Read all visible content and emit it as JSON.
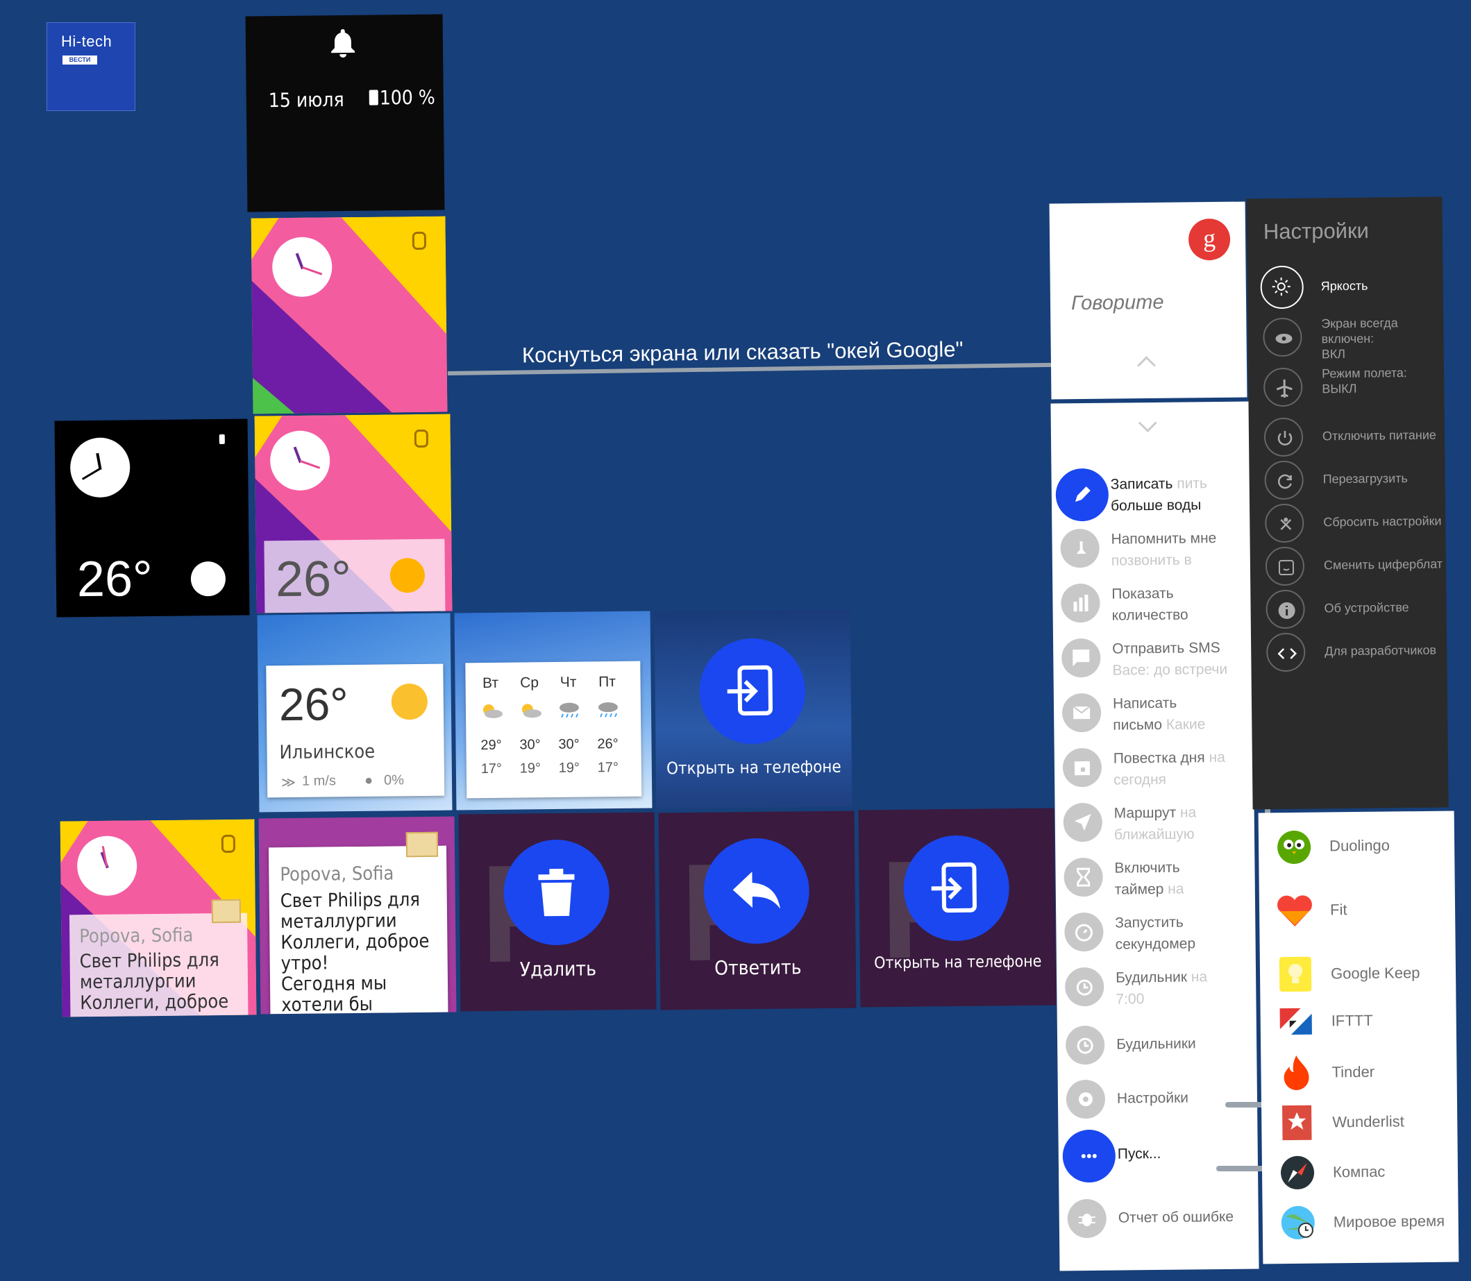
{
  "logo": {
    "title": "Hi-tech",
    "badge": "ВЕСТИ"
  },
  "lock": {
    "date": "15 июля",
    "battery": "100 %"
  },
  "caption": "Коснуться экрана или сказать \"окей Google\"",
  "weather": {
    "temp": "26°",
    "place": "Ильинское",
    "wind": "1 m/s",
    "rain": "0%",
    "forecast": [
      {
        "day": "Вт",
        "high": "29°",
        "low": "17°",
        "icon": "partly-sunny-icon"
      },
      {
        "day": "Ср",
        "high": "30°",
        "low": "19°",
        "icon": "partly-sunny-icon"
      },
      {
        "day": "Чт",
        "high": "30°",
        "low": "19°",
        "icon": "rain-icon"
      },
      {
        "day": "Пт",
        "high": "26°",
        "low": "17°",
        "icon": "rain-icon"
      }
    ]
  },
  "actions": {
    "open_phone": "Открыть на телефоне",
    "delete": "Удалить",
    "reply": "Ответить"
  },
  "mail": {
    "sender": "Popova, Sofia",
    "line1": "Свет Philips для",
    "line2": "металлургии",
    "line3": "Коллеги, доброе",
    "line4": "утро!",
    "line5": "Сегодня мы",
    "line6": "хотели бы",
    "mini_line3": "Коллеги, доброе"
  },
  "voice": {
    "google_badge": "g",
    "prompt": "Говорите",
    "items": [
      {
        "main": "Записать",
        "hint": " пить",
        "line2": "больше воды",
        "icon": "pencil-icon"
      },
      {
        "main": "Напомнить мне",
        "hint": "",
        "line2": "",
        "line2_hint": "позвонить в",
        "icon": "reminder-icon"
      },
      {
        "main": "Показать",
        "hint": "",
        "line2": "количество",
        "icon": "bar-chart-icon"
      },
      {
        "main": "Отправить SMS",
        "hint": "",
        "line2": "",
        "line2_hint": "Васе: до встречи",
        "icon": "sms-icon"
      },
      {
        "main": "Написать",
        "hint": "",
        "line2": "письмо",
        "line2_hint": " Какие",
        "icon": "mail-icon"
      },
      {
        "main": "Повестка дня",
        "hint": " на",
        "line2": "",
        "line2_hint": "сегодня",
        "icon": "calendar-icon"
      },
      {
        "main": "Маршрут",
        "hint": " на",
        "line2": "",
        "line2_hint": "ближайшую",
        "icon": "navigation-icon"
      },
      {
        "main": "Включить",
        "hint": "",
        "line2": "таймер",
        "line2_hint": " на",
        "icon": "hourglass-icon"
      },
      {
        "main": "Запустить",
        "hint": "",
        "line2": "секундомер",
        "icon": "stopwatch-icon"
      },
      {
        "main": "Будильник",
        "hint": " на",
        "line2": "",
        "line2_hint": "7:00",
        "icon": "alarm-icon"
      },
      {
        "main": "Будильники",
        "hint": "",
        "line2": "",
        "icon": "alarms-icon"
      },
      {
        "main": "Настройки",
        "hint": "",
        "line2": "",
        "icon": "gear-icon"
      },
      {
        "main": "Пуск...",
        "hint": "",
        "line2": "",
        "icon": "more-icon"
      },
      {
        "main": "Отчет об ошибке",
        "hint": "",
        "line2": "",
        "icon": "bug-icon"
      }
    ]
  },
  "settings": {
    "title": "Настройки",
    "items": [
      {
        "label": "Яркость",
        "icon": "brightness-icon"
      },
      {
        "label": "Экран всегда",
        "label2": "включен:",
        "label3": "ВКЛ",
        "icon": "eye-icon"
      },
      {
        "label": "Режим полета:",
        "label2": "ВЫКЛ",
        "icon": "airplane-icon"
      },
      {
        "label": "Отключить питание",
        "icon": "power-icon"
      },
      {
        "label": "Перезагрузить",
        "icon": "restart-icon"
      },
      {
        "label": "Сбросить настройки",
        "icon": "reset-icon"
      },
      {
        "label": "Сменить циферблат",
        "icon": "watchface-icon"
      },
      {
        "label": "Об устройстве",
        "icon": "info-icon"
      },
      {
        "label": "Для разработчиков",
        "icon": "code-icon"
      }
    ]
  },
  "apps": [
    {
      "label": "Duolingo",
      "icon": "duolingo-icon"
    },
    {
      "label": "Fit",
      "icon": "fit-heart-icon"
    },
    {
      "label": "Google Keep",
      "icon": "keep-bulb-icon"
    },
    {
      "label": "IFTTT",
      "icon": "ifttt-icon"
    },
    {
      "label": "Tinder",
      "icon": "tinder-flame-icon"
    },
    {
      "label": "Wunderlist",
      "icon": "wunderlist-star-icon"
    },
    {
      "label": "Компас",
      "icon": "compass-icon"
    },
    {
      "label": "Мировое время",
      "icon": "globe-icon"
    }
  ],
  "colors": {
    "background": "#173f79",
    "accent": "#1a47f0",
    "watchface_yellow": "#ffd300",
    "watchface_pink": "#f45ca0",
    "watchface_purple": "#6f1da6",
    "google_red": "#e53935"
  }
}
